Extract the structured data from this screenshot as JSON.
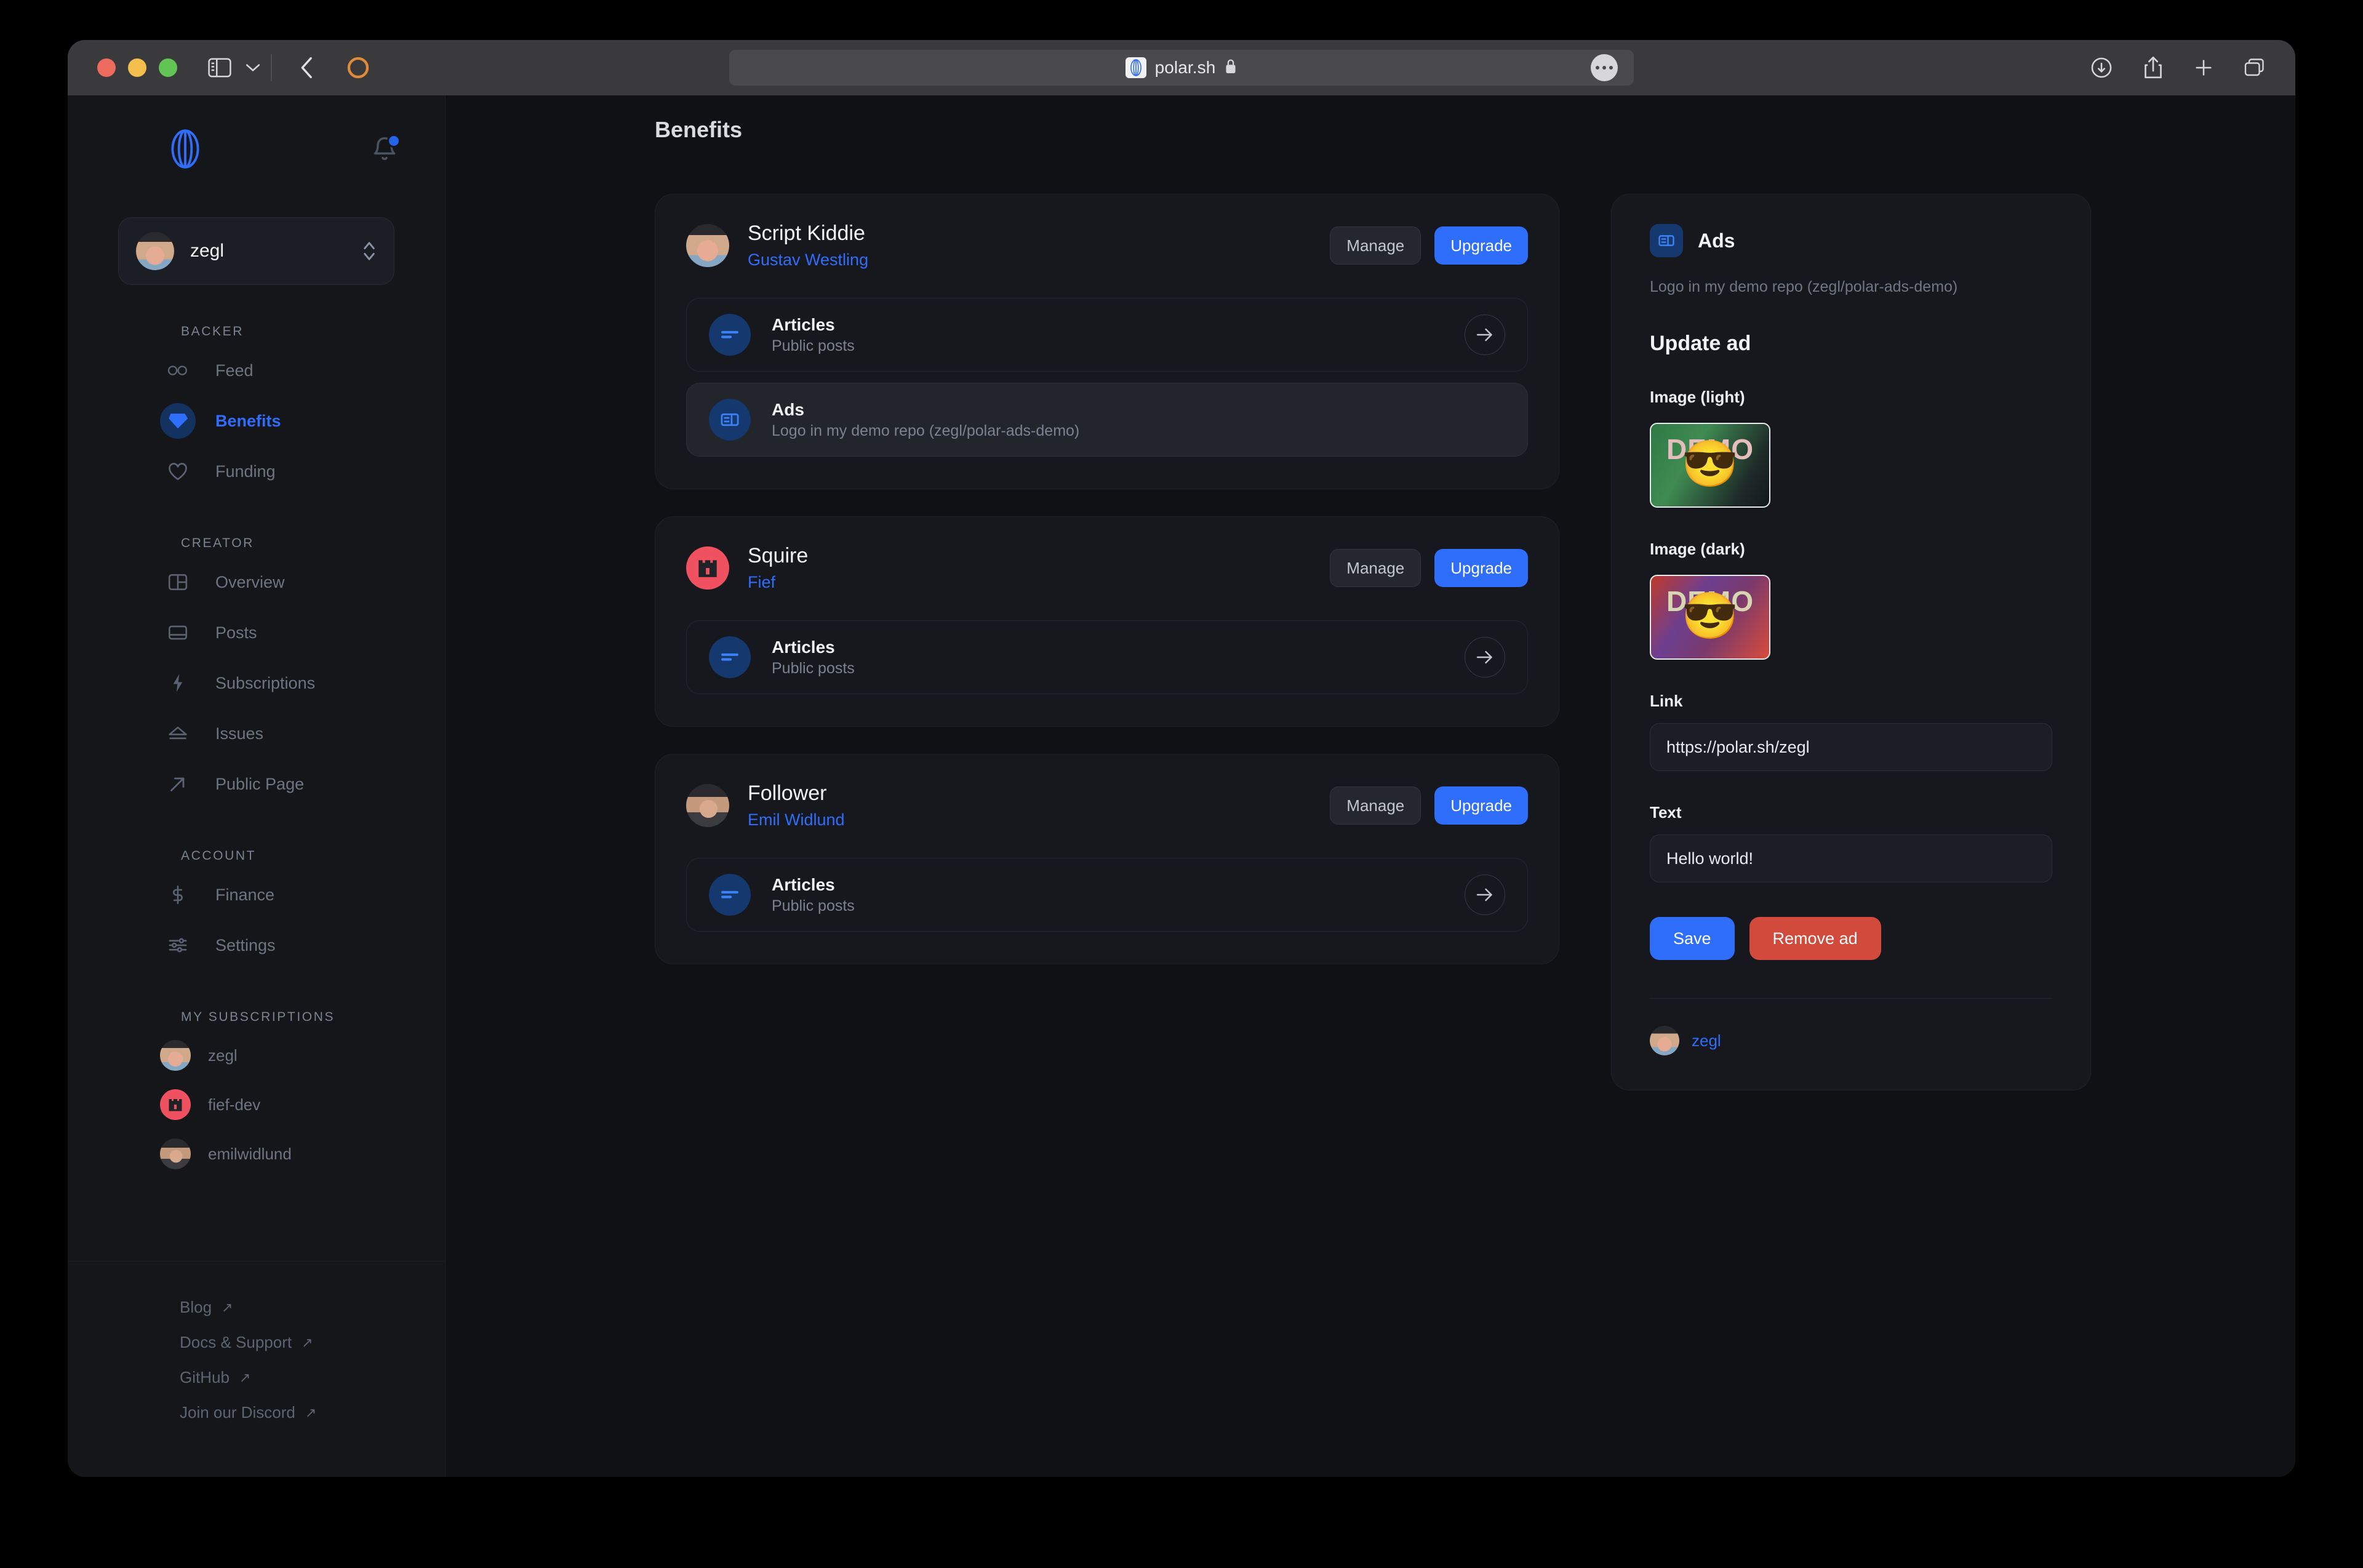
{
  "browser": {
    "url_host": "polar.sh",
    "icons": {
      "sidebar_toggle": "sidebar-toggle-icon",
      "chevron_down": "chevron-down-icon",
      "back": "back-arrow-icon",
      "reload": "reload-icon",
      "lock": "lock-icon",
      "more": "more-options-icon",
      "downloads": "downloads-icon",
      "share": "share-icon",
      "new_tab": "plus-icon",
      "tabs": "tab-overview-icon"
    }
  },
  "sidebar": {
    "logo": "polar-logo",
    "notifications_icon": "bell-icon",
    "profile": {
      "name": "zegl",
      "avatar": "zegl-avatar"
    },
    "sections": [
      {
        "label": "BACKER",
        "items": [
          {
            "label": "Feed",
            "icon": "infinity-icon",
            "active": false
          },
          {
            "label": "Benefits",
            "icon": "diamond-icon",
            "active": true
          },
          {
            "label": "Funding",
            "icon": "heart-icon",
            "active": false
          }
        ]
      },
      {
        "label": "CREATOR",
        "items": [
          {
            "label": "Overview",
            "icon": "layout-icon",
            "active": false
          },
          {
            "label": "Posts",
            "icon": "posts-icon",
            "active": false
          },
          {
            "label": "Subscriptions",
            "icon": "bolt-icon",
            "active": false
          },
          {
            "label": "Issues",
            "icon": "issues-icon",
            "active": false
          },
          {
            "label": "Public Page",
            "icon": "external-link-icon",
            "active": false
          }
        ]
      },
      {
        "label": "ACCOUNT",
        "items": [
          {
            "label": "Finance",
            "icon": "dollar-icon",
            "active": false
          },
          {
            "label": "Settings",
            "icon": "sliders-icon",
            "active": false
          }
        ]
      }
    ],
    "subscriptions_label": "MY SUBSCRIPTIONS",
    "subscriptions": [
      {
        "label": "zegl",
        "avatar": "zegl-avatar"
      },
      {
        "label": "fief-dev",
        "avatar": "fief-avatar"
      },
      {
        "label": "emilwidlund",
        "avatar": "emil-avatar"
      }
    ],
    "footer_links": [
      {
        "label": "Blog",
        "icon": "external-link-icon"
      },
      {
        "label": "Docs & Support",
        "icon": "external-link-icon"
      },
      {
        "label": "GitHub",
        "icon": "external-link-icon"
      },
      {
        "label": "Join our Discord",
        "icon": "external-link-icon"
      }
    ]
  },
  "main": {
    "page_title": "Benefits",
    "cards": [
      {
        "tier": "Script Kiddie",
        "creator": "Gustav Westling",
        "avatar": "zegl-avatar",
        "manage_label": "Manage",
        "upgrade_label": "Upgrade",
        "benefits": [
          {
            "title": "Articles",
            "subtitle": "Public posts",
            "icon": "articles-icon",
            "selected": false,
            "has_arrow": true
          },
          {
            "title": "Ads",
            "subtitle": "Logo in my demo repo (zegl/polar-ads-demo)",
            "icon": "ads-icon",
            "selected": true,
            "has_arrow": false
          }
        ]
      },
      {
        "tier": "Squire",
        "creator": "Fief",
        "avatar": "fief-avatar",
        "manage_label": "Manage",
        "upgrade_label": "Upgrade",
        "benefits": [
          {
            "title": "Articles",
            "subtitle": "Public posts",
            "icon": "articles-icon",
            "selected": false,
            "has_arrow": true
          }
        ]
      },
      {
        "tier": "Follower",
        "creator": "Emil Widlund",
        "avatar": "emil-avatar",
        "manage_label": "Manage",
        "upgrade_label": "Upgrade",
        "benefits": [
          {
            "title": "Articles",
            "subtitle": "Public posts",
            "icon": "articles-icon",
            "selected": false,
            "has_arrow": true
          }
        ]
      }
    ]
  },
  "panel": {
    "icon": "ads-icon",
    "title": "Ads",
    "subtitle": "Logo in my demo repo (zegl/polar-ads-demo)",
    "heading": "Update ad",
    "image_light_label": "Image (light)",
    "image_dark_label": "Image (dark)",
    "image_caption": "DEMO",
    "image_emoji": "😎",
    "link_label": "Link",
    "link_value": "https://polar.sh/zegl",
    "text_label": "Text",
    "text_value": "Hello world!",
    "save_label": "Save",
    "remove_label": "Remove ad",
    "footer_user": "zegl"
  },
  "colors": {
    "accent": "#2f6dfb",
    "danger": "#d14a3c",
    "page_bg": "#0f1115",
    "card_bg": "#16181d",
    "sidebar_bg": "#141619",
    "muted_text": "#6e7582"
  }
}
